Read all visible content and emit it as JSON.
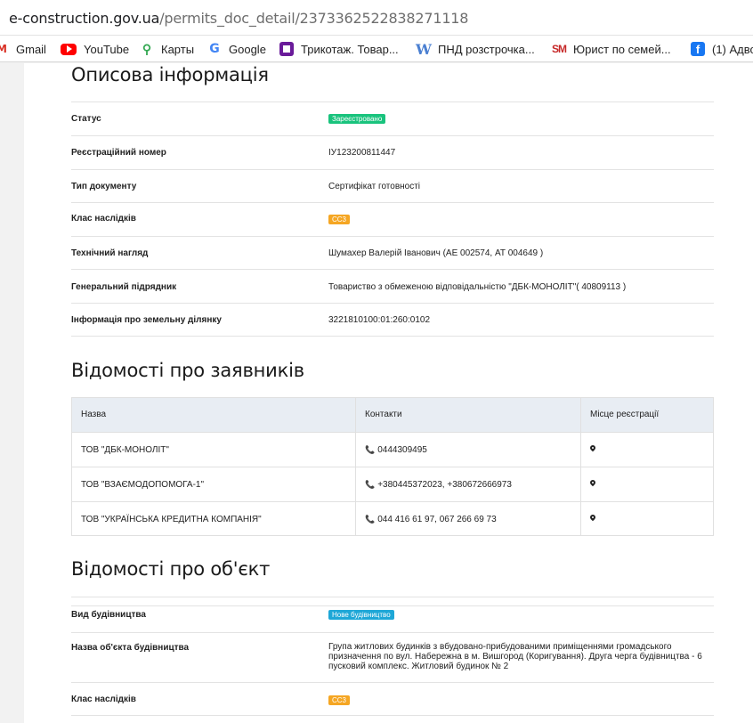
{
  "browser": {
    "url_host": "e-construction.gov.ua",
    "url_path": "/permits_doc_detail/2373362522838271118",
    "bookmarks": [
      {
        "label": "Gmail",
        "icon": "gmail-icon"
      },
      {
        "label": "YouTube",
        "icon": "youtube-icon"
      },
      {
        "label": "Карты",
        "icon": "maps-icon"
      },
      {
        "label": "Google",
        "icon": "google-icon"
      },
      {
        "label": "Трикотаж. Товар...",
        "icon": "purple-square-icon"
      },
      {
        "label": "ПНД розстрочка...",
        "icon": "w-icon"
      },
      {
        "label": "Юрист по семей...",
        "icon": "sm-icon"
      },
      {
        "label": "(1) Адво",
        "icon": "facebook-icon"
      }
    ]
  },
  "description": {
    "title": "Описова інформація",
    "rows": [
      {
        "label": "Статус",
        "badge": "Зареєстровано",
        "badge_color": "#19c37d"
      },
      {
        "label": "Реєстраційний номер",
        "value": "ІУ123200811447"
      },
      {
        "label": "Тип документу",
        "value": "Сертифікат готовності"
      },
      {
        "label": "Клас наслідків",
        "badge": "СС3",
        "badge_color": "#f5a623"
      },
      {
        "label": "Технічний нагляд",
        "value": "Шумахер Валерій Іванович (АЕ 002574, АТ 004649 )"
      },
      {
        "label": "Генеральний підрядник",
        "value": "Товариство з обмеженою відповідальністю \"ДБК-МОНОЛІТ\"( 40809113 )"
      },
      {
        "label": "Інформація про земельну ділянку",
        "value": "3221810100:01:260:0102"
      }
    ]
  },
  "applicants": {
    "title": "Відомості про заявників",
    "columns": [
      "Назва",
      "Контакти",
      "Місце реєстрації"
    ],
    "rows": [
      {
        "name": "ТОВ \"ДБК-МОНОЛІТ\"",
        "contacts": "0444309495"
      },
      {
        "name": "ТОВ \"ВЗАЄМОДОПОМОГА-1\"",
        "contacts": "+380445372023, +380672666973"
      },
      {
        "name": "ТОВ \"УКРАЇНСЬКА КРЕДИТНА КОМПАНІЯ\"",
        "contacts": "044 416 61 97, 067 266 69 73"
      }
    ]
  },
  "object": {
    "title": "Відомості про об'єкт",
    "rows": [
      {
        "label": "Вид будівництва",
        "badge": "Нове будівництво",
        "badge_color": "#1ea7d7"
      },
      {
        "label": "Назва об'єкта будівництва",
        "value": "Група житлових будинків з вбудовано-прибудованими приміщеннями громадського призначення по вул. Набережна в м. Вишгород (Коригування). Друга черга будівництва - 6 пусковий комплекс. Житловий будинок № 2"
      },
      {
        "label": "Клас наслідків",
        "badge": "СС3",
        "badge_color": "#f5a623"
      }
    ]
  }
}
